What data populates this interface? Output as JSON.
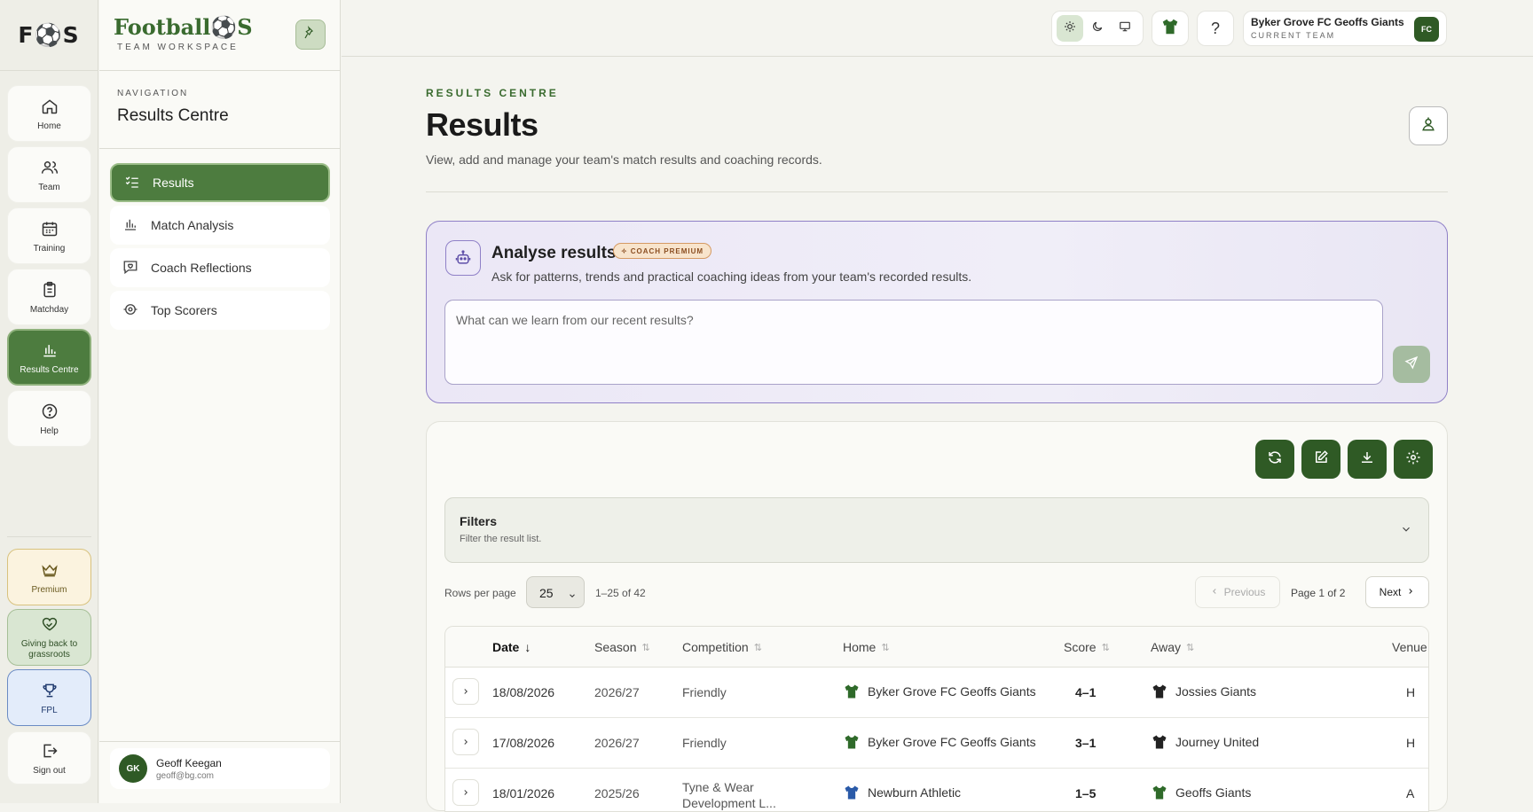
{
  "rail": {
    "logo": "F⚽S",
    "items": [
      {
        "label": "Home",
        "icon": "home-icon"
      },
      {
        "label": "Team",
        "icon": "users-icon"
      },
      {
        "label": "Training",
        "icon": "calendar-icon"
      },
      {
        "label": "Matchday",
        "icon": "clipboard-icon"
      },
      {
        "label": "Results Centre",
        "icon": "bar-chart-icon",
        "active": true
      },
      {
        "label": "Help",
        "icon": "help-circle-icon"
      }
    ],
    "bottom": [
      {
        "label": "Premium",
        "icon": "crown-icon"
      },
      {
        "label": "Giving back to grassroots",
        "icon": "heart-icon"
      },
      {
        "label": "FPL",
        "icon": "trophy-icon"
      },
      {
        "label": "Sign out",
        "icon": "sign-out-icon"
      }
    ]
  },
  "sidebar": {
    "brand": "Football⚽S",
    "brand_sub": "TEAM WORKSPACE",
    "nav_eyebrow": "NAVIGATION",
    "nav_title": "Results Centre",
    "items": [
      {
        "label": "Results",
        "icon": "list-check-icon",
        "active": true
      },
      {
        "label": "Match Analysis",
        "icon": "bar-chart-icon"
      },
      {
        "label": "Coach Reflections",
        "icon": "message-heart-icon"
      },
      {
        "label": "Top Scorers",
        "icon": "football-icon"
      }
    ],
    "user": {
      "initials": "GK",
      "name": "Geoff Keegan",
      "email": "geoff@bg.com"
    }
  },
  "topbar": {
    "help": "?",
    "team_name": "Byker Grove FC Geoffs Giants",
    "team_sub": "CURRENT TEAM",
    "team_badge": "FC"
  },
  "page": {
    "eyebrow": "RESULTS CENTRE",
    "title": "Results",
    "description": "View, add and manage your team's match results and coaching records."
  },
  "ai": {
    "title": "Analyse results",
    "badge": "COACH PREMIUM",
    "description": "Ask for patterns, trends and practical coaching ideas from your team's recorded results.",
    "placeholder": "What can we learn from our recent results?"
  },
  "filters": {
    "title": "Filters",
    "subtitle": "Filter the result list."
  },
  "pagination": {
    "rows_label": "Rows per page",
    "rows_value": "25",
    "range": "1–25 of 42",
    "previous": "Previous",
    "page_info": "Page 1 of 2",
    "next": "Next"
  },
  "table": {
    "columns": [
      "Date",
      "Season",
      "Competition",
      "Home",
      "Score",
      "Away",
      "Venue"
    ],
    "rows": [
      {
        "date": "18/08/2026",
        "season": "2026/27",
        "competition": "Friendly",
        "home": "Byker Grove FC Geoffs Giants",
        "home_kit": "#2f6a2a",
        "score": "4–1",
        "away": "Jossies Giants",
        "away_kit": "#222222",
        "venue": "H"
      },
      {
        "date": "17/08/2026",
        "season": "2026/27",
        "competition": "Friendly",
        "home": "Byker Grove FC Geoffs Giants",
        "home_kit": "#2f6a2a",
        "score": "3–1",
        "away": "Journey United",
        "away_kit": "#222222",
        "venue": "H"
      },
      {
        "date": "18/01/2026",
        "season": "2025/26",
        "competition": "Tyne & Wear Development L...",
        "home": "Newburn Athletic",
        "home_kit": "#2a5aa8",
        "score": "1–5",
        "away": "Geoffs Giants",
        "away_kit": "#2f6a2a",
        "venue": "A"
      }
    ]
  },
  "colors": {
    "brand_green": "#4d7c3f",
    "dark_green": "#2f5a25",
    "ai_border": "#8f80c7"
  }
}
